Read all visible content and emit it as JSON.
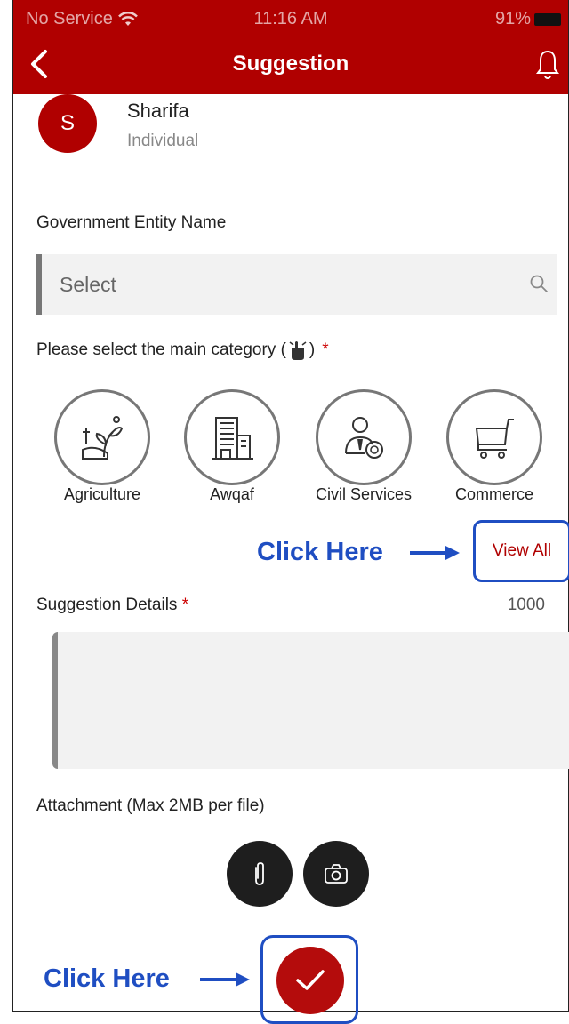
{
  "status_bar": {
    "carrier": "No Service",
    "time": "11:16 AM",
    "battery": "91%"
  },
  "header": {
    "title": "Suggestion"
  },
  "user": {
    "initial": "S",
    "name": "Sharifa",
    "type": "Individual"
  },
  "entity": {
    "label": "Government Entity Name",
    "placeholder": "Select"
  },
  "category": {
    "label": "Please select the main category (",
    "label_end": ")",
    "required_mark": "*",
    "items": [
      {
        "label": "Agriculture",
        "icon": "agriculture-icon"
      },
      {
        "label": "Awqaf",
        "icon": "building-icon"
      },
      {
        "label": "Civil Services",
        "icon": "civil-servant-icon"
      },
      {
        "label": "Commerce",
        "icon": "cart-icon"
      }
    ],
    "view_all": "View All"
  },
  "annotation": {
    "click_here_1": "Click Here",
    "click_here_2": "Click Here"
  },
  "details": {
    "label": "Suggestion Details",
    "required_mark": "*",
    "counter": "1000"
  },
  "attachment": {
    "label": "Attachment (Max 2MB per file)"
  },
  "colors": {
    "brand": "#b00000",
    "annotation": "#1f4ec2"
  }
}
